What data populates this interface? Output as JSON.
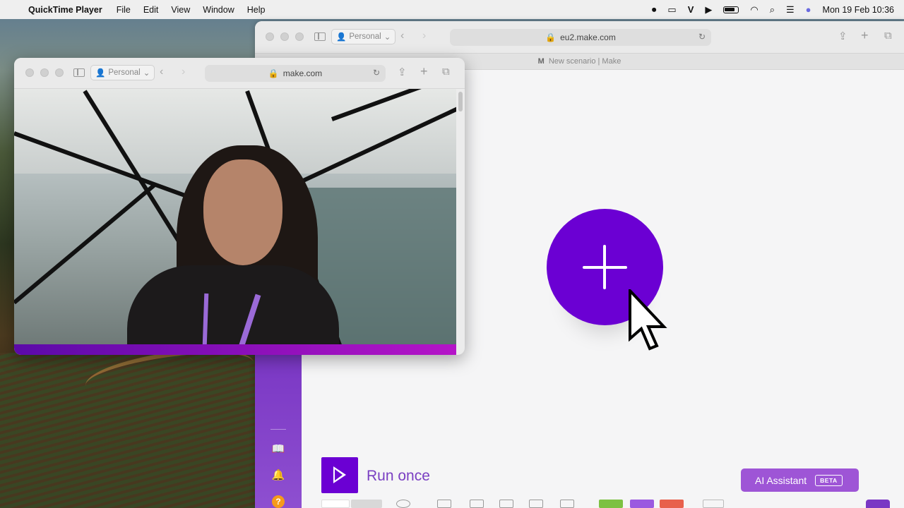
{
  "menubar": {
    "app_name": "QuickTime Player",
    "menus": [
      "File",
      "Edit",
      "View",
      "Window",
      "Help"
    ],
    "datetime": "Mon 19 Feb  10:36"
  },
  "back_window": {
    "profile": "Personal",
    "url": "eu2.make.com",
    "tab_title": "New scenario | Make"
  },
  "front_window": {
    "profile": "Personal",
    "url": "make.com"
  },
  "make": {
    "run_label": "Run once",
    "ai_label": "AI Assistant",
    "ai_badge": "BETA",
    "help_label": "?",
    "brand_color": "#6b00d3"
  },
  "icons": {
    "apple": "",
    "book": "book-icon",
    "bell": "bell-icon"
  }
}
